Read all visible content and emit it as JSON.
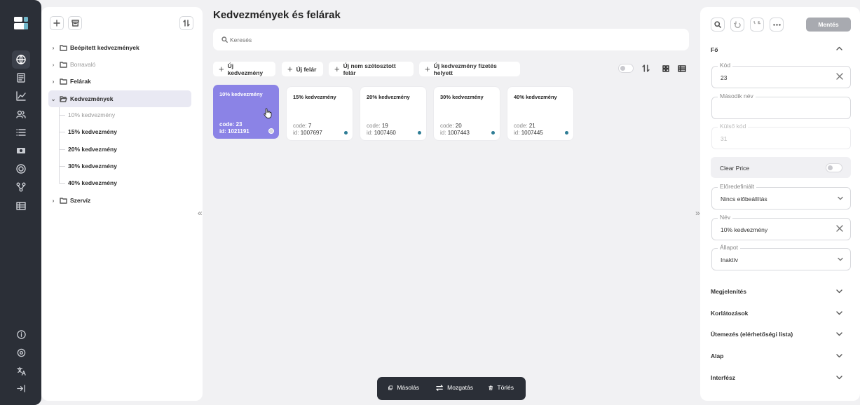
{
  "page": {
    "title": "Kedvezmények és felárak"
  },
  "search": {
    "placeholder": "Keresés"
  },
  "tree": {
    "items": [
      {
        "label": "Beépített kedvezmények"
      },
      {
        "label": "Borravaló"
      },
      {
        "label": "Felárak"
      },
      {
        "label": "Kedvezmények"
      },
      {
        "label": "Szervíz"
      }
    ],
    "children": [
      "10% kedvezmény",
      "15% kedvezmény",
      "20% kedvezmény",
      "30% kedvezmény",
      "40% kedvezmény"
    ]
  },
  "toolbar": {
    "new_discount": "Új kedvezmény",
    "new_surcharge": "Új felár",
    "new_undistributed_surcharge": "Új nem szétosztott felár",
    "new_discount_instead_of_payment": "Új kedvezmény fizetés helyett"
  },
  "cards": [
    {
      "title": "10% kedvezmény",
      "code_label": "code:",
      "code": "23",
      "id_label": "id:",
      "id": "1021191"
    },
    {
      "title": "15% kedvezmény",
      "code_label": "code:",
      "code": "7",
      "id_label": "id:",
      "id": "1007697"
    },
    {
      "title": "20% kedvezmény",
      "code_label": "code:",
      "code": "19",
      "id_label": "id:",
      "id": "1007460"
    },
    {
      "title": "30% kedvezmény",
      "code_label": "code:",
      "code": "20",
      "id_label": "id:",
      "id": "1007443"
    },
    {
      "title": "40% kedvezmény",
      "code_label": "code:",
      "code": "21",
      "id_label": "id:",
      "id": "1007445"
    }
  ],
  "bottom_bar": {
    "copy": "Másolás",
    "move": "Mozgatás",
    "delete": "Törlés"
  },
  "right": {
    "save": "Mentés",
    "section_main": "Fő",
    "fields": {
      "code": {
        "label": "Kód",
        "value": "23"
      },
      "second_name": {
        "label": "Második név",
        "value": ""
      },
      "external_code": {
        "label": "Külső kód",
        "placeholder": "31"
      },
      "clear_price": {
        "label": "Clear Price"
      },
      "predefined": {
        "label": "Előredefiniált",
        "value": "Nincs előbeállítás"
      },
      "name": {
        "label": "Név",
        "value": "10% kedvezmény"
      },
      "status": {
        "label": "Állapot",
        "value": "Inaktív"
      }
    },
    "sections": [
      "Megjelenítés",
      "Korlátozások",
      "Ütemezés (elérhetőségi lista)",
      "Alap",
      "Interfész"
    ]
  },
  "colors": {
    "accent": "#8b83e6",
    "rail": "#2b2f37",
    "save_button": "#a8aab0"
  },
  "icons": [
    "logo-icon",
    "globe-icon",
    "document-icon",
    "chart-icon",
    "users-icon",
    "list-icon",
    "cash-icon",
    "lifebuoy-icon",
    "flow-icon",
    "table-icon",
    "info-icon",
    "gear-icon",
    "translate-icon",
    "logout-icon"
  ]
}
